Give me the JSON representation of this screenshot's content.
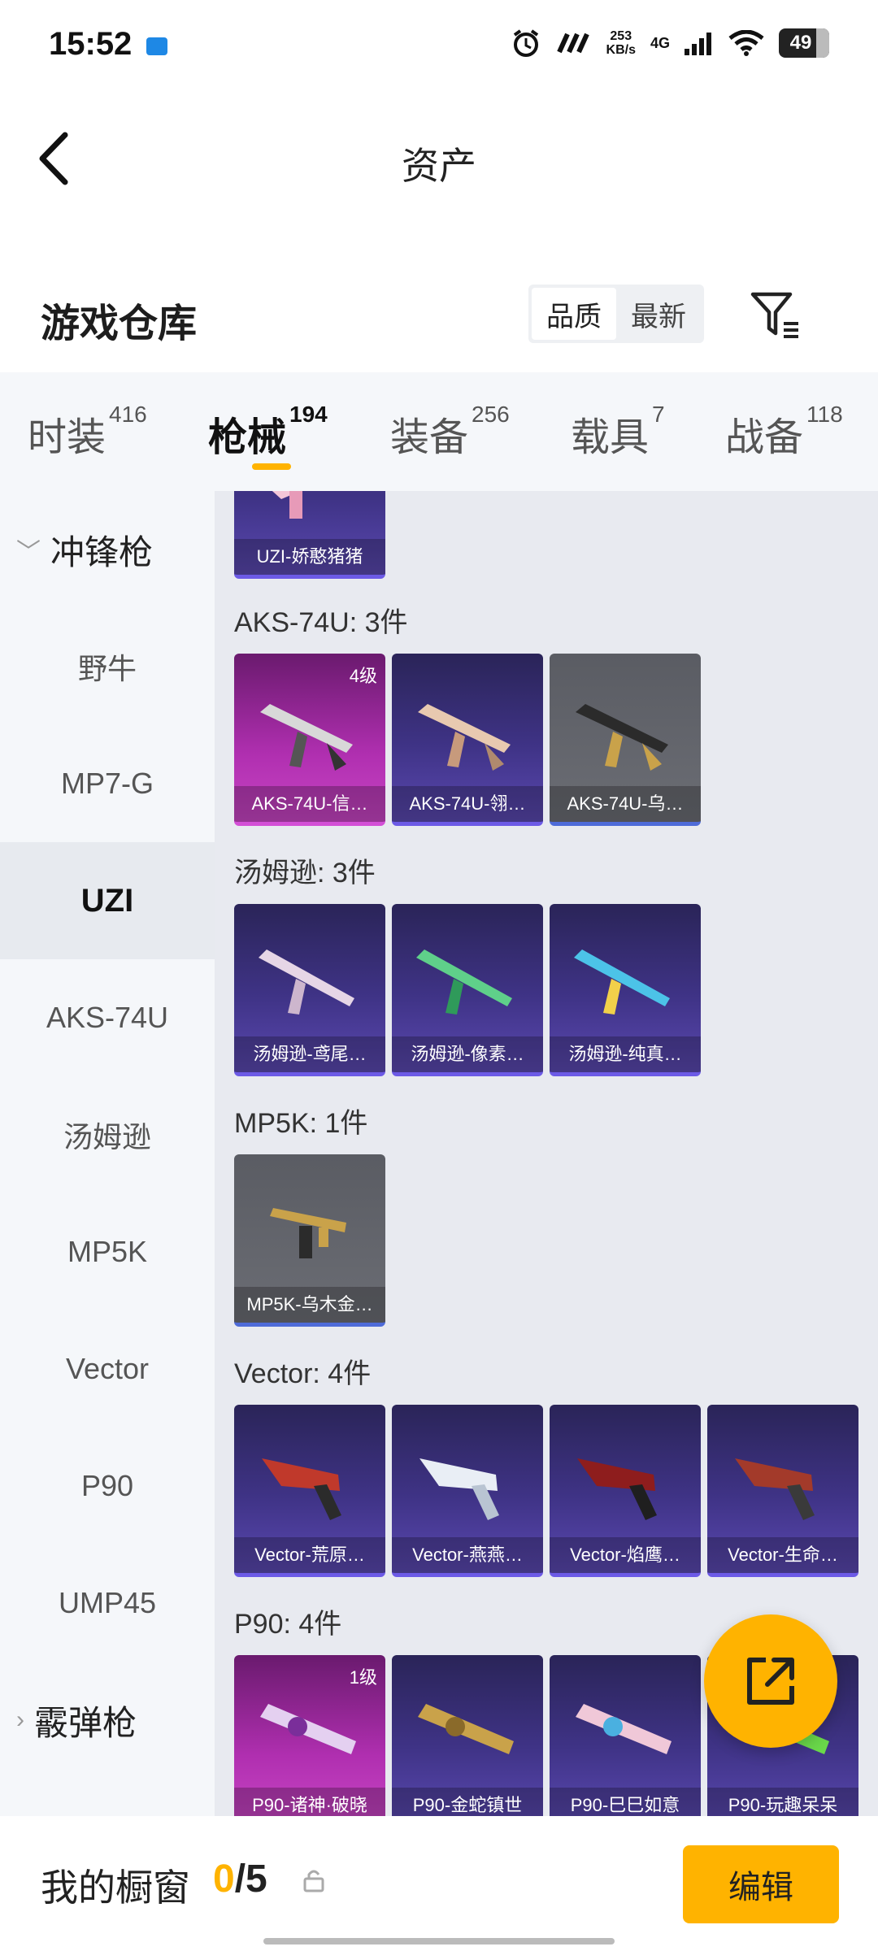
{
  "status": {
    "time": "15:52",
    "speed_value": "253",
    "speed_unit": "KB/s",
    "network": "4G",
    "battery": "49"
  },
  "header": {
    "title": "资产"
  },
  "warehouse": {
    "title": "游戏仓库",
    "sort_options": [
      "品质",
      "最新"
    ],
    "sort_active": "品质"
  },
  "tabs": [
    {
      "label": "时装",
      "count": "416"
    },
    {
      "label": "枪械",
      "count": "194",
      "active": true
    },
    {
      "label": "装备",
      "count": "256"
    },
    {
      "label": "载具",
      "count": "7"
    },
    {
      "label": "战备",
      "count": "118"
    }
  ],
  "sidebar": {
    "group_top": "冲锋枪",
    "items": [
      "野牛",
      "MP7-G",
      "UZI",
      "AKS-74U",
      "汤姆逊",
      "MP5K",
      "Vector",
      "P90",
      "UMP45"
    ],
    "active": "UZI",
    "group_bottom": "霰弹枪"
  },
  "content": {
    "partial_card": "UZI-娇憨猪猪",
    "groups": [
      {
        "label": "AKS-74U: 3件",
        "cards": [
          {
            "name": "AKS-74U-信…",
            "level": "4级",
            "style": "pink"
          },
          {
            "name": "AKS-74U-翎…",
            "style": "purple"
          },
          {
            "name": "AKS-74U-乌…",
            "style": "gray"
          }
        ]
      },
      {
        "label": "汤姆逊: 3件",
        "cards": [
          {
            "name": "汤姆逊-鸢尾…",
            "style": "purple"
          },
          {
            "name": "汤姆逊-像素…",
            "style": "purple"
          },
          {
            "name": "汤姆逊-纯真…",
            "style": "purple"
          }
        ]
      },
      {
        "label": "MP5K: 1件",
        "cards": [
          {
            "name": "MP5K-乌木金…",
            "style": "gray"
          }
        ]
      },
      {
        "label": "Vector: 4件",
        "cards": [
          {
            "name": "Vector-荒原…",
            "style": "purple"
          },
          {
            "name": "Vector-燕燕…",
            "style": "purple"
          },
          {
            "name": "Vector-焰鹰…",
            "style": "purple"
          },
          {
            "name": "Vector-生命…",
            "style": "purple"
          }
        ]
      },
      {
        "label": "P90: 4件",
        "cards": [
          {
            "name": "P90-诸神·破晓",
            "level": "1级",
            "style": "pink"
          },
          {
            "name": "P90-金蛇镇世",
            "style": "purple"
          },
          {
            "name": "P90-巳巳如意",
            "style": "purple"
          },
          {
            "name": "P90-玩趣呆呆",
            "style": "purple"
          }
        ]
      }
    ]
  },
  "bottom": {
    "showcase_label": "我的橱窗",
    "showcase_current": "0",
    "showcase_total": "/5",
    "edit_label": "编辑"
  },
  "colors": {
    "accent": "#ffb300",
    "rare": "#6c5ae6",
    "epic": "#d34fd6"
  }
}
